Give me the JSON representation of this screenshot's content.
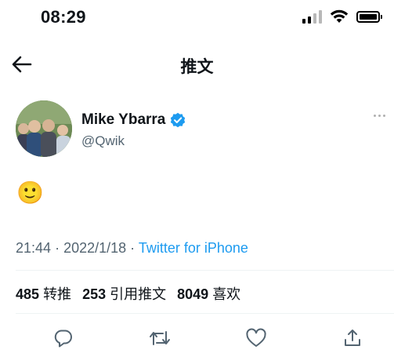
{
  "status_bar": {
    "time": "08:29",
    "signal_icon": "cellular-signal-icon",
    "wifi_icon": "wifi-icon",
    "battery_icon": "battery-icon"
  },
  "nav": {
    "back_icon": "arrow-left-icon",
    "title": "推文"
  },
  "author": {
    "name": "Mike Ybarra",
    "handle": "@Qwik",
    "verified_icon": "verified-badge-icon",
    "more_icon": "more-dots-icon"
  },
  "tweet": {
    "text": "🙂"
  },
  "meta": {
    "time": "21:44",
    "separator": "·",
    "date": "2022/1/18",
    "source": "Twitter for iPhone"
  },
  "stats": {
    "retweets_count": "485",
    "retweets_label": "转推",
    "quotes_count": "253",
    "quotes_label": "引用推文",
    "likes_count": "8049",
    "likes_label": "喜欢"
  },
  "actions": {
    "reply_icon": "reply-icon",
    "retweet_icon": "retweet-icon",
    "like_icon": "heart-icon",
    "share_icon": "share-icon"
  },
  "colors": {
    "accent": "#1d9bf0",
    "text_primary": "#0f1419",
    "text_secondary": "#536471",
    "divider": "#eff3f4"
  }
}
